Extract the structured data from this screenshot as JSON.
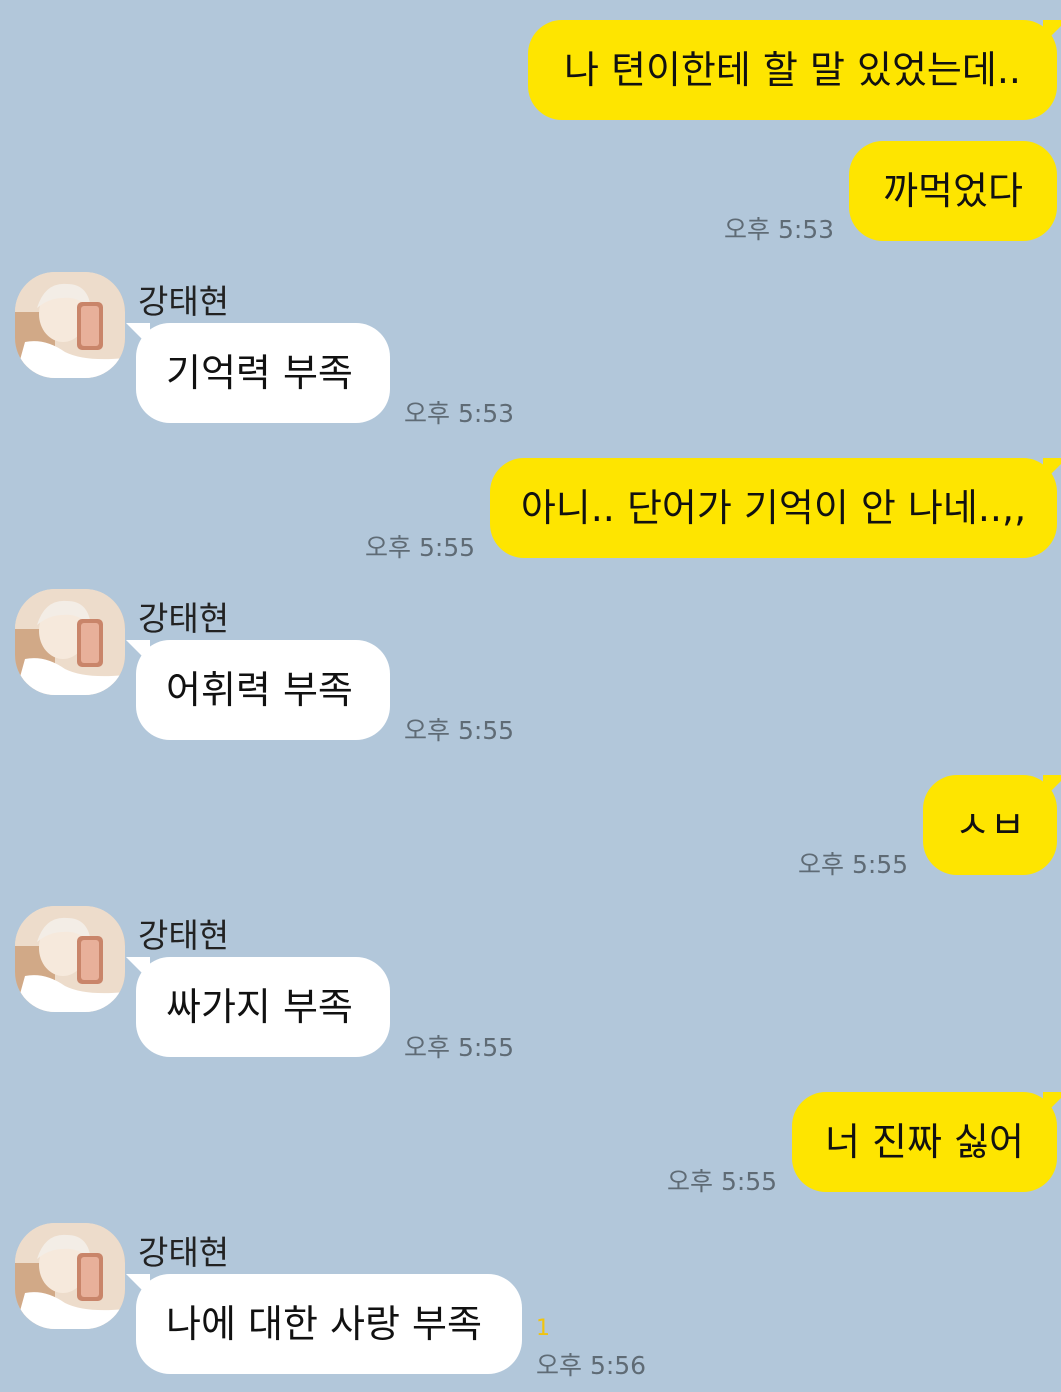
{
  "contact": {
    "name": "강태현"
  },
  "messages": [
    {
      "from": "me",
      "text": "나 텬이한테 할 말 있었는데..",
      "time": ""
    },
    {
      "from": "me",
      "text": "까먹었다",
      "time": "오후 5:53"
    },
    {
      "from": "them",
      "sender": "강태현",
      "text": "기억력 부족",
      "time": "오후 5:53"
    },
    {
      "from": "me",
      "text": "아니.. 단어가 기억이 안 나네..,,",
      "time": "오후 5:55"
    },
    {
      "from": "them",
      "sender": "강태현",
      "text": "어휘력 부족",
      "time": "오후 5:55"
    },
    {
      "from": "me",
      "text": "ㅅㅂ",
      "time": "오후 5:55"
    },
    {
      "from": "them",
      "sender": "강태현",
      "text": "싸가지 부족",
      "time": "오후 5:55"
    },
    {
      "from": "me",
      "text": "너 진짜 싫어",
      "time": "오후 5:55"
    },
    {
      "from": "them",
      "sender": "강태현",
      "text": "나에 대한 사랑 부족",
      "time": "오후 5:56",
      "unread": "1"
    }
  ],
  "colors": {
    "background": "#b2c7da",
    "my_bubble": "#fee500",
    "their_bubble": "#ffffff",
    "unread": "#f1c40f"
  }
}
